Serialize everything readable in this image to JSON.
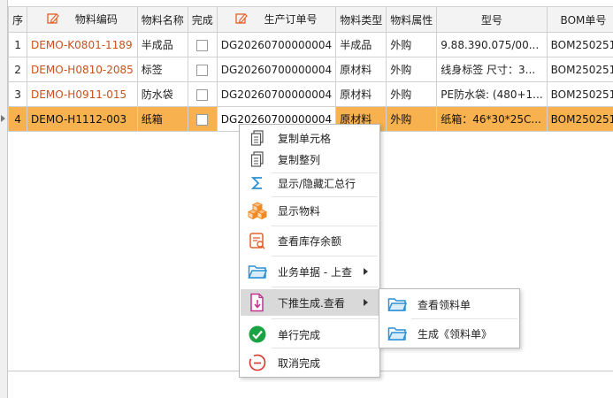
{
  "columns": {
    "seq": "序",
    "material_code": "物料编码",
    "material_name": "物料名称",
    "done": "完成",
    "order_no": "生产订单号",
    "material_type": "物料类型",
    "material_attr": "物料属性",
    "model": "型号",
    "bom_no": "BOM单号"
  },
  "rows": [
    {
      "seq": "1",
      "code": "DEMO-K0801-1189",
      "name": "半成品",
      "order": "DG20260700000004",
      "type": "半成品",
      "attr": "外购",
      "model": "9.88.390.075/00...",
      "bom": "BOM250251"
    },
    {
      "seq": "2",
      "code": "DEMO-H0810-2085",
      "name": "标签",
      "order": "DG20260700000004",
      "type": "原材料",
      "attr": "外购",
      "model": "线身标签 尺寸：3...",
      "bom": "BOM250251"
    },
    {
      "seq": "3",
      "code": "DEMO-H0911-015",
      "name": "防水袋",
      "order": "DG20260700000004",
      "type": "原材料",
      "attr": "外购",
      "model": "PE防水袋: (480+1...",
      "bom": "BOM250251"
    },
    {
      "seq": "4",
      "code": "DEMO-H1112-003",
      "name": "纸箱",
      "order": "DG20260700000004",
      "type": "原材料",
      "attr": "外购",
      "model": "纸箱：46*30*25C...",
      "bom": "BOM250251"
    }
  ],
  "selected_row": 4,
  "context_menu": {
    "copy_cell": "复制单元格",
    "copy_column": "复制整列",
    "toggle_summary": "显示/隐藏汇总行",
    "show_material": "显示物料",
    "view_stock": "查看库存余额",
    "business_up": "业务单据 - 上查",
    "push_down": "下推生成.查看",
    "row_done": "单行完成",
    "cancel_done": "取消完成"
  },
  "submenu": {
    "view_picking": "查看领料单",
    "create_picking": "生成《领料单》"
  },
  "colors": {
    "selected_row": "#f7b14f",
    "code_text": "#c8501e",
    "folder_blue": "#2a8fd6",
    "check_green": "#1aa344",
    "cancel_red": "#d9342b",
    "cube_orange": "#f08a24"
  }
}
